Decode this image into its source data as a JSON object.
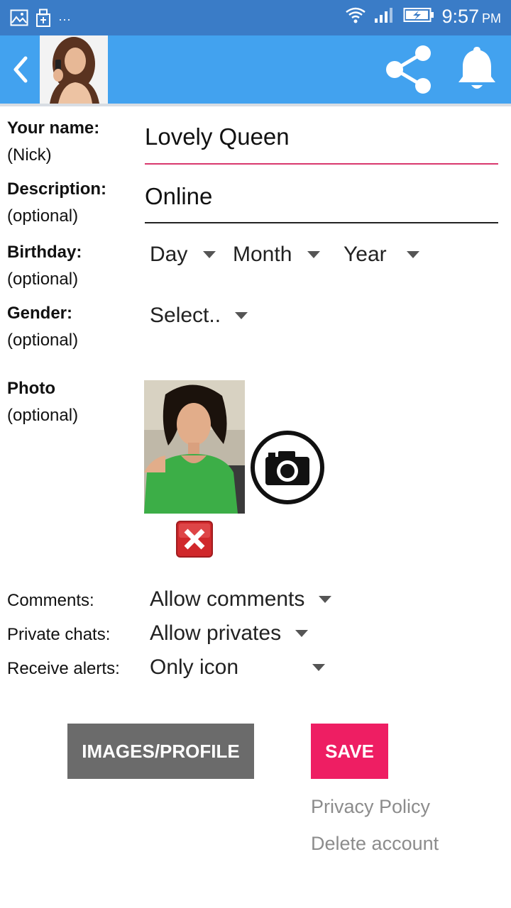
{
  "status_bar": {
    "time": "9:57",
    "ampm": "PM",
    "dots": "···"
  },
  "form": {
    "name": {
      "label": "Your name:",
      "sub": "(Nick)",
      "value": "Lovely Queen"
    },
    "description": {
      "label": "Description:",
      "sub": "(optional)",
      "value": "Online"
    },
    "birthday": {
      "label": "Birthday:",
      "sub": "(optional)",
      "day": "Day",
      "month": "Month",
      "year": "Year"
    },
    "gender": {
      "label": "Gender:",
      "sub": "(optional)",
      "value": "Select.."
    },
    "photo": {
      "label": "Photo",
      "sub": "(optional)"
    },
    "comments": {
      "label": "Comments:",
      "value": "Allow comments"
    },
    "private_chats": {
      "label": "Private chats:",
      "value": "Allow privates"
    },
    "receive_alerts": {
      "label": "Receive alerts:",
      "value": "Only icon"
    }
  },
  "buttons": {
    "images_profile": "IMAGES/PROFILE",
    "save": "SAVE"
  },
  "links": {
    "privacy": "Privacy Policy",
    "delete": "Delete account"
  },
  "colors": {
    "status_bar": "#3a7cc7",
    "app_bar": "#42a2ef",
    "accent": "#ee1e63",
    "gray_button": "#6b6b6b"
  }
}
